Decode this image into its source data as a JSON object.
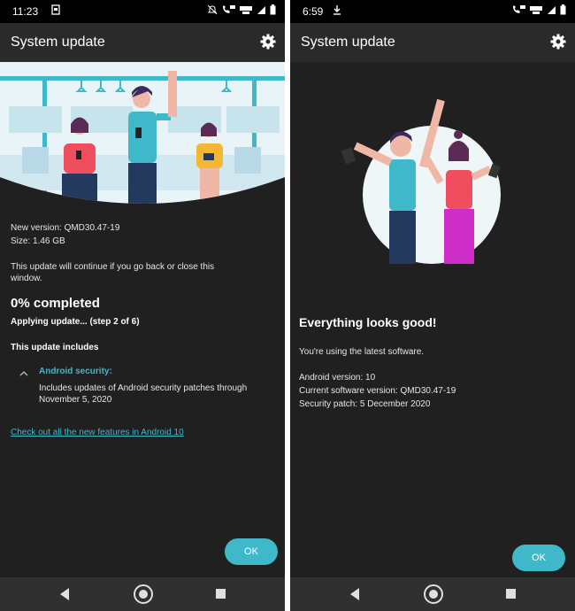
{
  "left": {
    "status": {
      "time": "11:23"
    },
    "appbar": {
      "title": "System update"
    },
    "version_line": "New version: QMD30.47-19",
    "size_line": "Size: 1.46 GB",
    "continue_line1": "This update will continue if you go back or close this",
    "continue_line2": "window.",
    "progress": "0% completed",
    "applying": "Applying update... (step 2 of 6)",
    "includes_heading": "This update includes",
    "security_title": "Android security:",
    "security_line1": "Includes updates of Android security patches through",
    "security_line2": "November 5, 2020",
    "features_link": "Check out all the new features in Android 10",
    "ok": "OK"
  },
  "right": {
    "status": {
      "time": "6:59"
    },
    "appbar": {
      "title": "System update"
    },
    "everything_good": "Everything looks good!",
    "latest": "You're using the latest software.",
    "android_version": "Android version: 10",
    "current_version": "Current software version: QMD30.47-19",
    "security_patch": "Security patch: 5 December 2020",
    "ok": "OK"
  },
  "colors": {
    "accent": "#3fb9c9",
    "background": "#202020",
    "appbar": "#2a2a2a"
  }
}
